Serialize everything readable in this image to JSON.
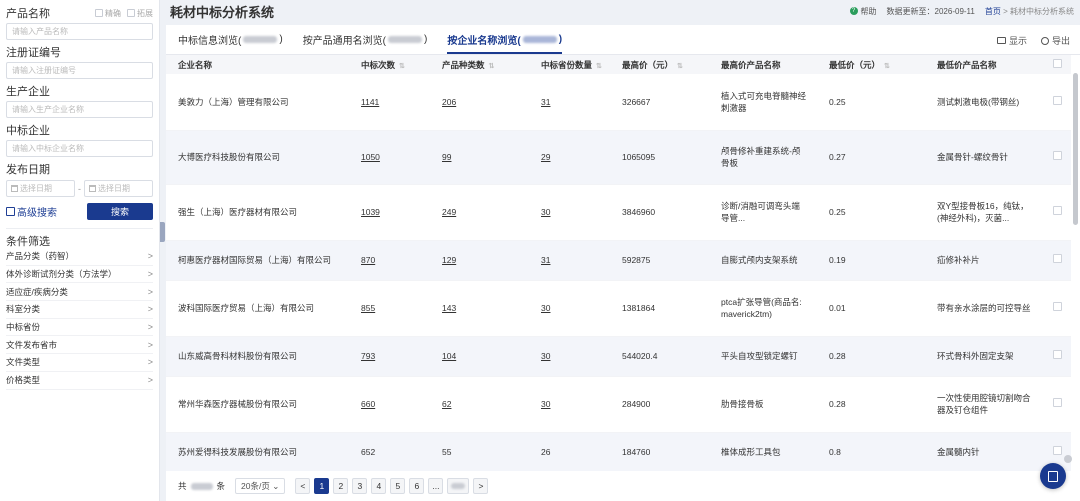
{
  "sidebar": {
    "product_name_label": "产品名称",
    "check_exact": "精确",
    "check_expand": "拓展",
    "product_name_placeholder": "请输入产品名称",
    "reg_label": "注册证编号",
    "reg_placeholder": "请输入注册证编号",
    "maker_label": "生产企业",
    "maker_placeholder": "请输入生产企业名称",
    "winner_label": "中标企业",
    "winner_placeholder": "请输入中标企业名称",
    "date_label": "发布日期",
    "date_start_placeholder": "选择日期",
    "date_end_placeholder": "选择日期",
    "date_separator": "-",
    "advanced_search": "高级搜索",
    "search_button": "搜索",
    "filter_title": "条件筛选",
    "filters": [
      {
        "label": "产品分类（药智）"
      },
      {
        "label": "体外诊断试剂分类（方法学）"
      },
      {
        "label": "适应症/疾病分类"
      },
      {
        "label": "科室分类"
      },
      {
        "label": "中标省份"
      },
      {
        "label": "文件发布省市"
      },
      {
        "label": "文件类型"
      },
      {
        "label": "价格类型"
      }
    ]
  },
  "header": {
    "title": "耗材中标分析系统",
    "help": "帮助",
    "update_label": "数据更新至：2026-09-11",
    "crumb_home": "首页",
    "crumb_sep": ">",
    "crumb_current": "耗材中标分析系统"
  },
  "tabs": [
    {
      "label": "中标信息浏览("
    },
    {
      "label": "按产品通用名浏览("
    },
    {
      "label": "按企业名称浏览("
    }
  ],
  "tab_close": ")",
  "tools": {
    "display": "显示",
    "export": "导出"
  },
  "table": {
    "headers": [
      "企业名称",
      "中标次数",
      "产品种类数",
      "中标省份数量",
      "最高价（元）",
      "最高价产品名称",
      "最低价（元）",
      "最低价产品名称"
    ],
    "rows": [
      {
        "company": "美敦力（上海）管理有限公司",
        "wins": "1141",
        "kinds": "206",
        "provinces": "31",
        "max_price": "326667",
        "max_product": "植入式可充电脊髓神经刺激器",
        "min_price": "0.25",
        "min_product": "测试刺激电极(带钢丝)"
      },
      {
        "company": "大博医疗科技股份有限公司",
        "wins": "1050",
        "kinds": "99",
        "provinces": "29",
        "max_price": "1065095",
        "max_product": "颅骨修补重建系统-颅骨板",
        "min_price": "0.27",
        "min_product": "金属骨针-螺纹骨针"
      },
      {
        "company": "强生（上海）医疗器材有限公司",
        "wins": "1039",
        "kinds": "249",
        "provinces": "30",
        "max_price": "3846960",
        "max_product": "诊断/消融可调弯头端导管...",
        "min_price": "0.25",
        "min_product": "双Y型接骨板16，纯钛，(神经外科)，灭菌..."
      },
      {
        "company": "柯惠医疗器材国际贸易（上海）有限公司",
        "wins": "870",
        "kinds": "129",
        "provinces": "31",
        "max_price": "592875",
        "max_product": "自膨式颅内支架系统",
        "min_price": "0.19",
        "min_product": "疝修补补片"
      },
      {
        "company": "波科国际医疗贸易（上海）有限公司",
        "wins": "855",
        "kinds": "143",
        "provinces": "30",
        "max_price": "1381864",
        "max_product": "ptca扩张导管(商品名: maverick2tm)",
        "min_price": "0.01",
        "min_product": "带有亲水涂层的可控导丝"
      },
      {
        "company": "山东威高骨科材料股份有限公司",
        "wins": "793",
        "kinds": "104",
        "provinces": "30",
        "max_price": "544020.4",
        "max_product": "平头自攻型锁定螺钉",
        "min_price": "0.28",
        "min_product": "环式骨科外固定支架"
      },
      {
        "company": "常州华森医疗器械股份有限公司",
        "wins": "660",
        "kinds": "62",
        "provinces": "30",
        "max_price": "284900",
        "max_product": "肋骨接骨板",
        "min_price": "0.28",
        "min_product": "一次性使用腔镜切割吻合器及钉仓组件"
      },
      {
        "company": "苏州爱得科技发展股份有限公司",
        "wins": "652",
        "kinds": "55",
        "provinces": "26",
        "max_price": "184760",
        "max_product": "椎体成形工具包",
        "min_price": "0.8",
        "min_product": "金属髓内针"
      }
    ]
  },
  "pager": {
    "total_prefix": "共",
    "total_suffix": "条",
    "page_size": "20条/页",
    "prev": "<",
    "next": ">",
    "pages": [
      "1",
      "2",
      "3",
      "4",
      "5",
      "6",
      "..."
    ]
  },
  "colors": {
    "brand": "#1a3a8f",
    "help_icon": "#2a9d5c"
  }
}
